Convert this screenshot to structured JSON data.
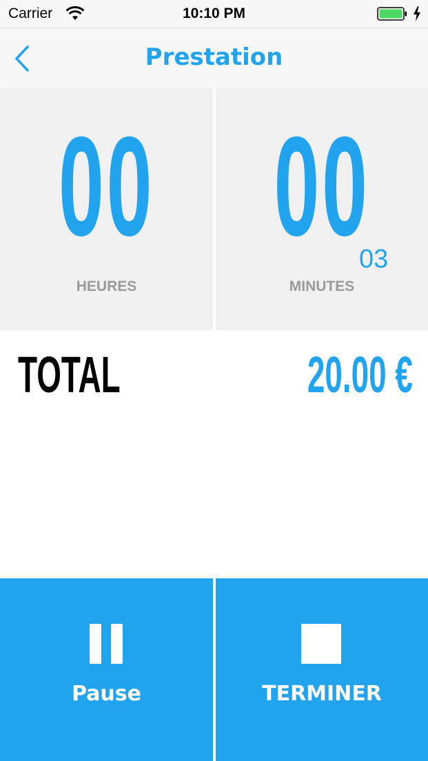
{
  "colors": {
    "accent": "#22a3ed",
    "panel_bg": "#f0f0f0",
    "label_gray": "#9a9a9a",
    "battery_green": "#4cd964"
  },
  "status_bar": {
    "carrier": "Carrier",
    "time": "10:10 PM",
    "icons": [
      "wifi-icon",
      "battery-icon",
      "charging-bolt-icon"
    ]
  },
  "nav": {
    "title": "Prestation",
    "back_icon": "chevron-left-icon"
  },
  "timer": {
    "hours": "00",
    "hours_label": "HEURES",
    "minutes": "00",
    "minutes_label": "MINUTES",
    "seconds": "03"
  },
  "total": {
    "label": "TOTAL",
    "value": "20.00 €"
  },
  "actions": {
    "pause": {
      "label": "Pause",
      "icon": "pause-icon"
    },
    "finish": {
      "label": "TERMINER",
      "icon": "stop-icon"
    }
  }
}
